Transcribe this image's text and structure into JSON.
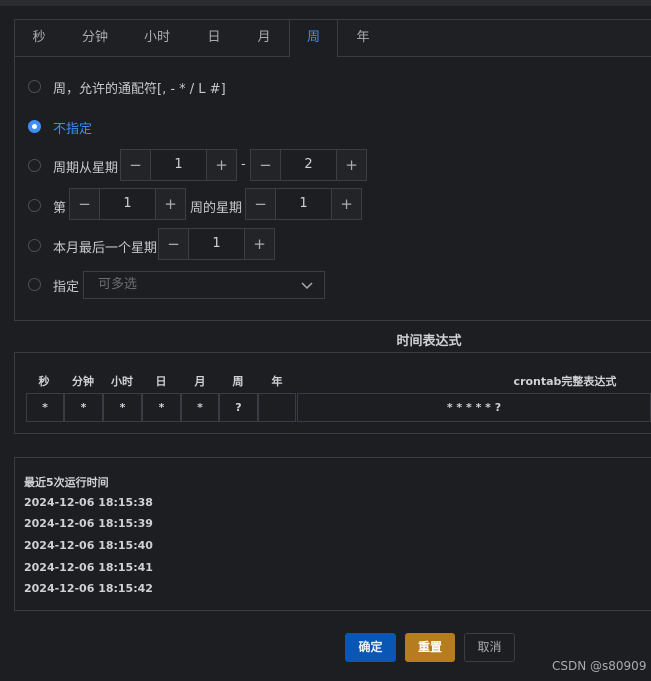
{
  "tabs": [
    "秒",
    "分钟",
    "小时",
    "日",
    "月",
    "周",
    "年"
  ],
  "active_tab": "周",
  "options": {
    "wildcard_label": "周，允许的通配符[, - * / L #]",
    "unspecified_label": "不指定",
    "range_label": "周期从星期",
    "range_from": "1",
    "range_sep": "-",
    "range_to": "2",
    "nth_prefix": "第",
    "nth_week": "1",
    "nth_middle": "周的星期",
    "nth_day": "1",
    "last_label": "本月最后一个星期",
    "last_value": "1",
    "specify_label": "指定",
    "specify_placeholder": "可多选"
  },
  "stepper": {
    "minus": "−",
    "plus": "+"
  },
  "expression": {
    "title": "时间表达式",
    "headers": [
      "秒",
      "分钟",
      "小时",
      "日",
      "月",
      "周",
      "年"
    ],
    "values": [
      "*",
      "*",
      "*",
      "*",
      "*",
      "?",
      ""
    ],
    "full_header": "crontab完整表达式",
    "full_value": "* * * * * ?"
  },
  "runs": {
    "title": "最近5次运行时间",
    "items": [
      "2024-12-06 18:15:38",
      "2024-12-06 18:15:39",
      "2024-12-06 18:15:40",
      "2024-12-06 18:15:41",
      "2024-12-06 18:15:42"
    ]
  },
  "buttons": {
    "confirm": "确定",
    "reset": "重置",
    "cancel": "取消"
  },
  "watermark": "CSDN @s80909",
  "colors": {
    "accent": "#3e8ef7",
    "confirm": "#0a56b5",
    "reset": "#b57d1e"
  }
}
